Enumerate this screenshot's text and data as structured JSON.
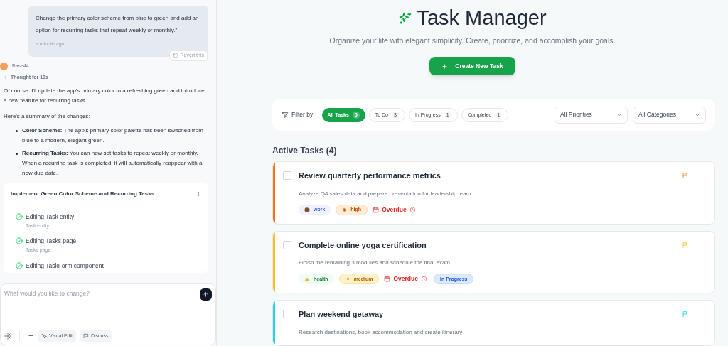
{
  "chat": {
    "user_message": {
      "text": "Change the primary color scheme from blue to green and add an option for recurring tasks that repeat weekly or monthly.\"",
      "time": "a minute ago",
      "revert": "Revert this"
    },
    "assistant": {
      "name": "Base44",
      "thought": "Thought for 18s",
      "intro": "Of course. I'll update the app's primary color to a refreshing green and introduce a new feature for recurring tasks.",
      "summary_heading": "Here's a summary of the changes:",
      "bullets": [
        "**Color Scheme:** The app's primary color palette has been switched from blue to a modern, elegant green.",
        "**Recurring Tasks:** You can now set tasks to repeat weekly or monthly. When a recurring task is completed, it will automatically reappear with a new due date."
      ]
    },
    "plan": {
      "title": "Implement Green Color Scheme and Recurring Tasks",
      "steps": [
        {
          "title": "Editing Task entity",
          "subtitle": "Task entity",
          "done": true
        },
        {
          "title": "Editing Tasks page",
          "subtitle": "Tasks page",
          "done": true
        },
        {
          "title": "Editing TaskForm component",
          "done": true
        }
      ]
    },
    "composer": {
      "placeholder": "What would you like to change?",
      "buttons": [
        "Visual Edit",
        "Discuss"
      ]
    }
  },
  "app": {
    "title": "Task Manager",
    "subtitle": "Organize your life with elegant simplicity. Create, prioritize, and accomplish your goals.",
    "create_button": "Create New Task",
    "filter_label": "Filter by:",
    "filters": [
      {
        "label": "All Tasks",
        "count": "5",
        "selected": true
      },
      {
        "label": "To Do",
        "count": "3",
        "selected": false
      },
      {
        "label": "In Progress",
        "count": "1",
        "selected": false
      },
      {
        "label": "Completed",
        "count": "1",
        "selected": false
      }
    ],
    "selects": [
      "All Priorities",
      "All Categories"
    ],
    "section_title": "Active Tasks (4)",
    "tasks": [
      {
        "title": "Review quarterly performance metrics",
        "description": "Analyze Q4 sales data and prepare presentation for leadership team",
        "color": "#f97316",
        "checked": false,
        "category": {
          "kind": "work",
          "label": "work"
        },
        "priority": {
          "kind": "high",
          "label": "high"
        },
        "due": "Overdue"
      },
      {
        "title": "Complete online yoga certification",
        "description": "Finish the remaining 3 modules and schedule the final exam",
        "color": "#fbbf24",
        "checked": false,
        "category": {
          "kind": "health",
          "label": "health"
        },
        "priority": {
          "kind": "medium",
          "label": "medium"
        },
        "due": "Overdue",
        "status": "In Progress"
      },
      {
        "title": "Plan weekend getaway",
        "description": "Research destinations, book accommodation and create itinerary",
        "color": "#22d3ee",
        "checked": false
      }
    ]
  }
}
